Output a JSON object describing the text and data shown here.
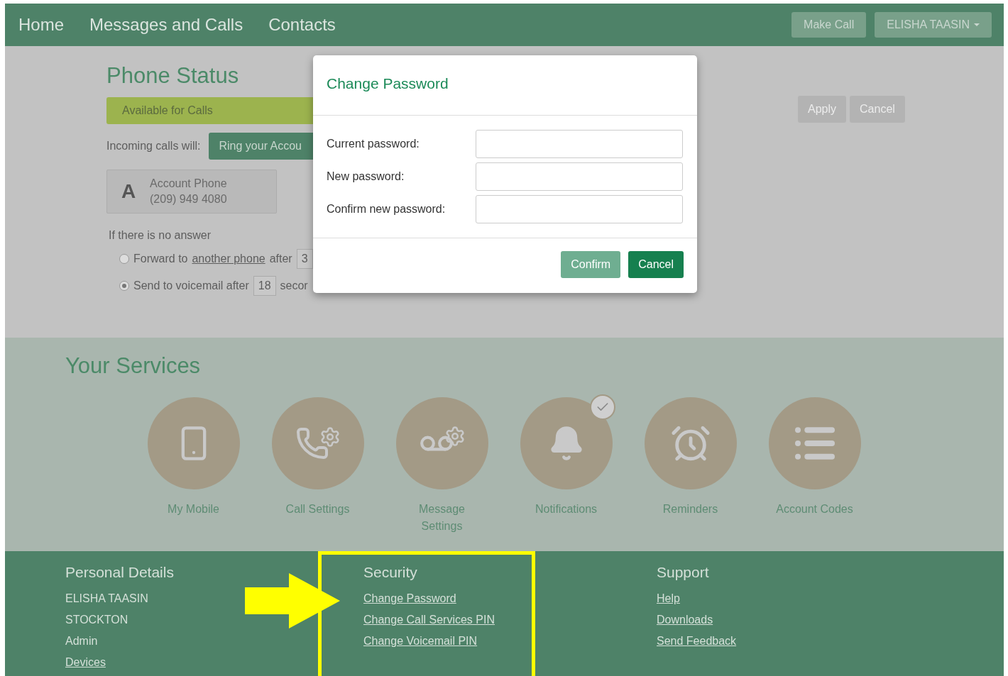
{
  "nav": {
    "items": [
      {
        "label": "Home"
      },
      {
        "label": "Messages and Calls"
      },
      {
        "label": "Contacts"
      }
    ],
    "buttons": [
      {
        "label": "Make Call",
        "caret": false
      },
      {
        "label": "ELISHA TAASIN",
        "caret": true
      }
    ]
  },
  "phone_status": {
    "title": "Phone Status",
    "status": "Available for Calls",
    "incoming_label": "Incoming calls will:",
    "incoming_action": "Ring your Accou",
    "account": {
      "letter": "A",
      "name": "Account Phone",
      "number": "(209) 949 4080"
    },
    "no_answer_label": "If there is no answer",
    "options": [
      {
        "before": "Forward to ",
        "link": "another phone ",
        "after": "after",
        "value": "3",
        "selected": false
      },
      {
        "before": "Send to voicemail after",
        "value": "18",
        "unit": "secor",
        "selected": true
      }
    ],
    "actions": [
      {
        "label": "Apply",
        "disabled": true
      },
      {
        "label": "Cancel",
        "disabled": true
      }
    ]
  },
  "dialog": {
    "title": "Change Password",
    "fields": [
      {
        "label": "Current password:"
      },
      {
        "label": "New password:"
      },
      {
        "label": "Confirm new password:"
      }
    ],
    "buttons": [
      {
        "label": "Confirm",
        "kind": "secondary"
      },
      {
        "label": "Cancel",
        "kind": "primary"
      }
    ]
  },
  "services": {
    "title": "Your Services",
    "items": [
      {
        "label": "My Mobile",
        "kind": "mobile",
        "checked": false
      },
      {
        "label": "Call Settings",
        "kind": "call-settings",
        "checked": false
      },
      {
        "label": "Message Settings",
        "kind": "voicemail-settings",
        "checked": false
      },
      {
        "label": "Notifications",
        "kind": "bell",
        "checked": true
      },
      {
        "label": "Reminders",
        "kind": "alarm",
        "checked": false
      },
      {
        "label": "Account Codes",
        "kind": "list",
        "checked": false
      }
    ]
  },
  "footer": {
    "columns": [
      {
        "title": "Personal Details",
        "highlighted": false,
        "items": [
          {
            "label": "ELISHA TAASIN",
            "link": false
          },
          {
            "label": "STOCKTON",
            "link": false
          },
          {
            "label": "Admin",
            "link": false
          },
          {
            "label": "Devices",
            "link": true
          }
        ]
      },
      {
        "title": "Security",
        "highlighted": true,
        "items": [
          {
            "label": "Change Password",
            "link": true
          },
          {
            "label": "Change Call Services PIN",
            "link": true
          },
          {
            "label": "Change Voicemail PIN",
            "link": true
          }
        ]
      },
      {
        "title": "Support",
        "highlighted": false,
        "items": [
          {
            "label": "Help",
            "link": true
          },
          {
            "label": "Downloads",
            "link": true
          },
          {
            "label": "Send Feedback",
            "link": true
          }
        ]
      }
    ]
  }
}
